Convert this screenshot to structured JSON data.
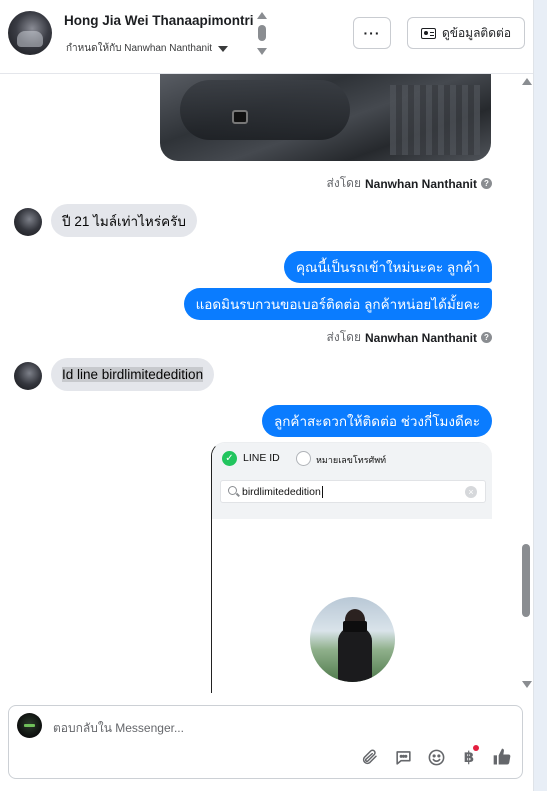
{
  "header": {
    "contact_name": "Hong Jia Wei Thanaapimontri",
    "assigned_text": "กำหนดให้กับ Nanwhan Nanthanit",
    "more_label": "···",
    "contact_info_label": "ดูข้อมูลติดต่อ"
  },
  "messages": {
    "sent_by_prefix": "ส่งโดย",
    "sent_by_name": "Nanwhan Nanthanit",
    "help_mark": "?",
    "incoming_1": "ปี 21 ไมล์เท่าไหร่ครับ",
    "outgoing_1": "คุณนี้เป็นรถเข้าใหม่นะคะ ลูกค้า",
    "outgoing_2": "แอดมินรบกวนขอเบอร์ติดต่อ ลูกค้าหน่อยได้มั้ยคะ",
    "incoming_2": "Id line birdlimitededition",
    "outgoing_3": "ลูกค้าสะดวกให้ติดต่อ ช่วงกี่โมงดีคะ"
  },
  "line_screenshot": {
    "option_line_id": "LINE ID",
    "option_phone": "หมายเลขโทรศัพท์",
    "search_value": "birdlimitededition",
    "check_mark": "✓",
    "clear_mark": "×"
  },
  "composer": {
    "placeholder": "ตอบกลับใน Messenger...",
    "baht_symbol": "฿"
  },
  "colors": {
    "outgoing_bubble": "#0a7cff",
    "incoming_bubble": "#e4e6eb",
    "line_green": "#22c55e",
    "notification_red": "#e41e3f"
  },
  "icons": [
    "scroll-up-icon",
    "scroll-down-icon",
    "contact-card-icon",
    "help-icon",
    "search-icon",
    "clear-icon",
    "check-icon",
    "attachment-icon",
    "saved-replies-icon",
    "emoji-icon",
    "payment-icon",
    "thumbs-up-icon"
  ]
}
